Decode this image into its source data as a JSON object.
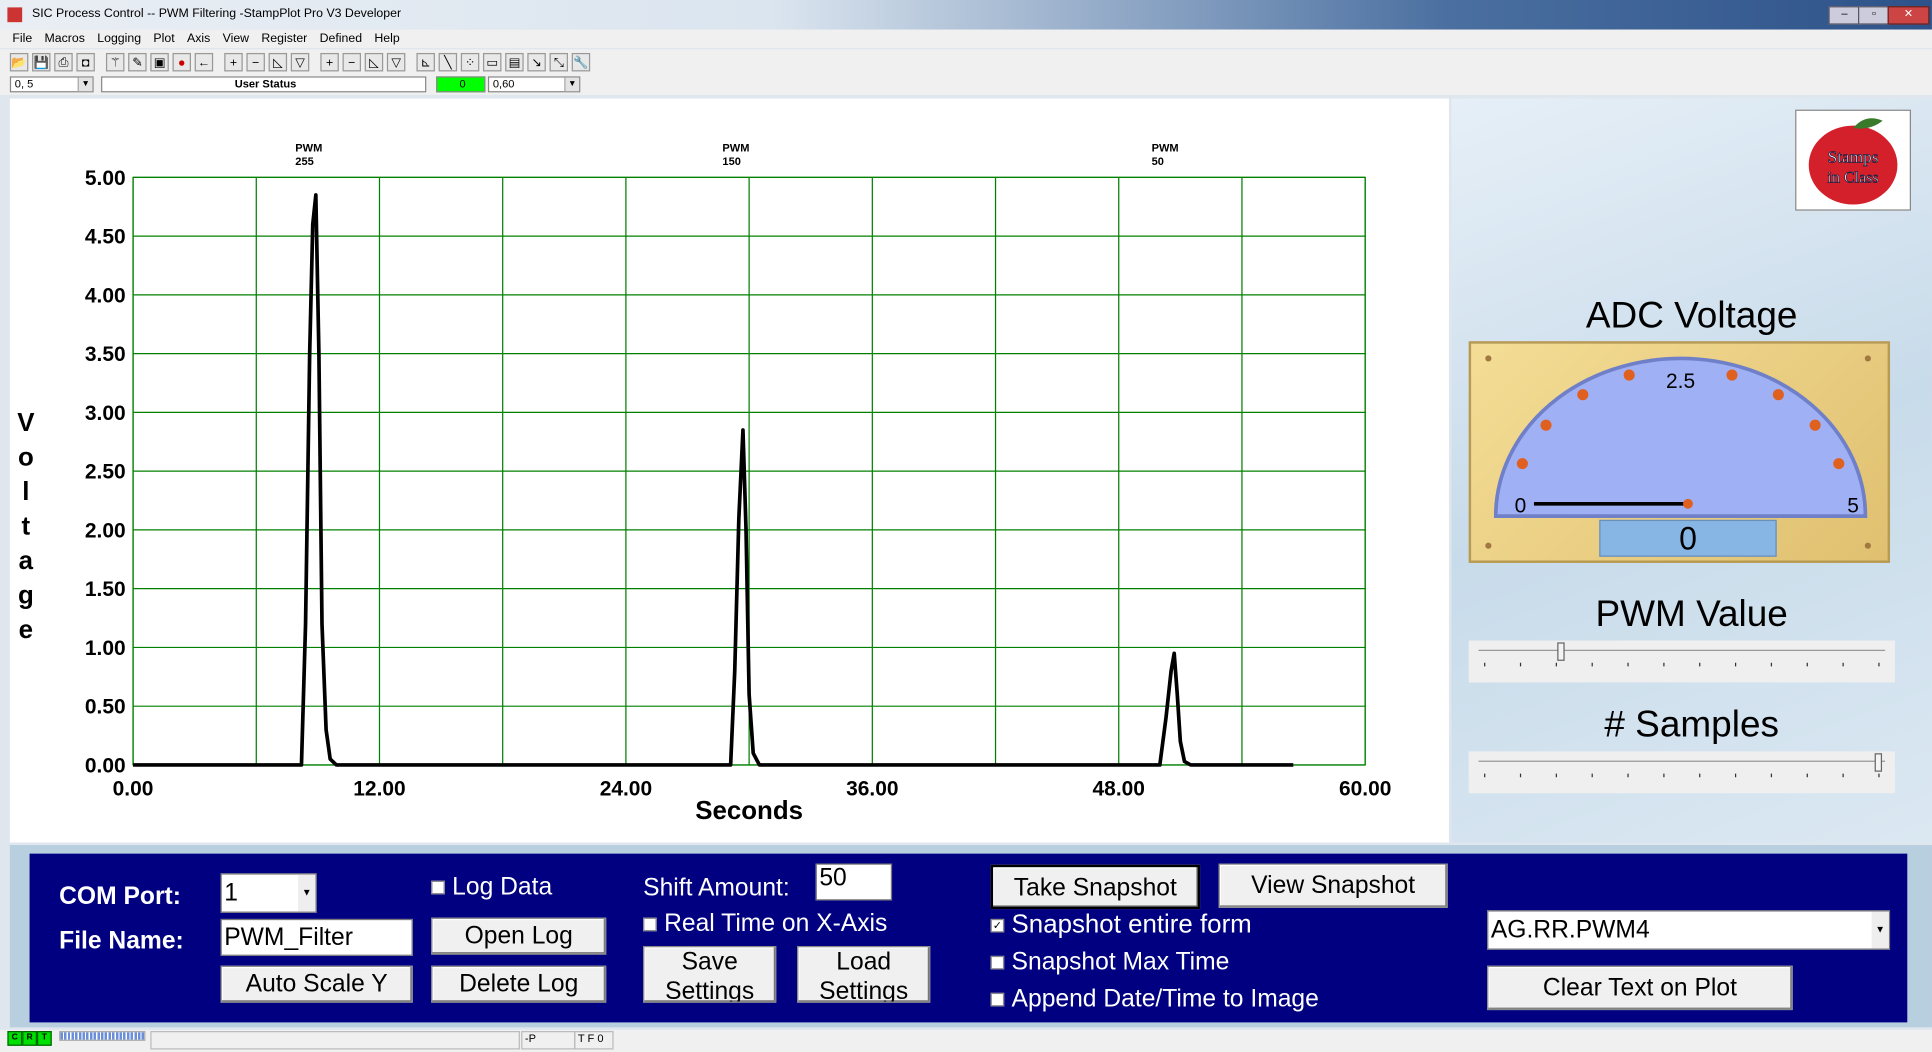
{
  "window": {
    "title": "SIC Process Control -- PWM Filtering  -StampPlot Pro V3 Developer"
  },
  "menu": [
    "File",
    "Macros",
    "Logging",
    "Plot",
    "Axis",
    "View",
    "Register",
    "Defined",
    "Help"
  ],
  "toolbar_icons": [
    "open-icon",
    "save-icon",
    "print-icon",
    "camera-icon",
    "wand-icon",
    "plot-icon",
    "monitor-icon",
    "stop-icon",
    "back-arrow-icon",
    "plus-icon",
    "minus-icon",
    "ruler-icon",
    "ruler-v-icon",
    "plus-icon",
    "minus-icon",
    "ruler-icon",
    "ruler-v-icon",
    "axis-icon",
    "pen-icon",
    "points-icon",
    "note-icon",
    "clipboard-icon",
    "pointer-icon",
    "graph-icon",
    "wrench-icon"
  ],
  "status_row": {
    "left_select": "0, 5",
    "user_status": "User Status",
    "indicator": "0",
    "right_select": "0,60",
    "indicator_color": "#00ff00"
  },
  "chart_data": {
    "type": "line",
    "xlabel": "Seconds",
    "ylabel": "Voltage",
    "xlim": [
      0,
      60
    ],
    "ylim": [
      0,
      5
    ],
    "x_ticks": [
      "0.00",
      "12.00",
      "24.00",
      "36.00",
      "48.00",
      "60.00"
    ],
    "y_ticks": [
      "0.00",
      "0.50",
      "1.00",
      "1.50",
      "2.00",
      "2.50",
      "3.00",
      "3.50",
      "4.00",
      "4.50",
      "5.00"
    ],
    "grid": true,
    "grid_color": "#008000",
    "line_color": "#000000",
    "annotations": [
      {
        "x": 8.5,
        "text": [
          "PWM",
          "255"
        ]
      },
      {
        "x": 29.3,
        "text": [
          "PWM",
          "150"
        ]
      },
      {
        "x": 50.2,
        "text": [
          "PWM",
          "50"
        ]
      }
    ],
    "points": [
      [
        0,
        0
      ],
      [
        8.2,
        0
      ],
      [
        8.4,
        1.2
      ],
      [
        8.6,
        3.5
      ],
      [
        8.75,
        4.6
      ],
      [
        8.9,
        4.85
      ],
      [
        9.05,
        3.5
      ],
      [
        9.2,
        1.2
      ],
      [
        9.4,
        0.3
      ],
      [
        9.6,
        0.05
      ],
      [
        9.9,
        0
      ],
      [
        29.1,
        0
      ],
      [
        29.3,
        0.8
      ],
      [
        29.5,
        2.1
      ],
      [
        29.7,
        2.85
      ],
      [
        29.85,
        2.0
      ],
      [
        30.0,
        0.6
      ],
      [
        30.2,
        0.1
      ],
      [
        30.5,
        0
      ],
      [
        50.0,
        0
      ],
      [
        50.3,
        0.4
      ],
      [
        50.55,
        0.8
      ],
      [
        50.7,
        0.95
      ],
      [
        50.85,
        0.6
      ],
      [
        51.0,
        0.2
      ],
      [
        51.2,
        0.03
      ],
      [
        51.5,
        0
      ],
      [
        56.5,
        0
      ]
    ]
  },
  "right": {
    "adc_title": "ADC Voltage",
    "gauge": {
      "min": "0",
      "mid": "2.5",
      "max": "5",
      "readout": "0",
      "value": 0
    },
    "pwm_title": "PWM Value",
    "pwm_fraction": 0.2,
    "samples_title": "# Samples",
    "samples_fraction": 1.0,
    "logo": "www.Stamps in Class .com"
  },
  "panel": {
    "com_label": "COM Port:",
    "com_value": "1",
    "file_label": "File Name:",
    "file_value": "PWM_Filter",
    "auto_scale": "Auto Scale Y",
    "log_data": "Log Data",
    "open_log": "Open Log",
    "delete_log": "Delete Log",
    "shift_label": "Shift Amount:",
    "shift_value": "50",
    "real_time": "Real Time on X-Axis",
    "save_settings": [
      "Save",
      "Settings"
    ],
    "load_settings": [
      "Load",
      "Settings"
    ],
    "take_snapshot": "Take Snapshot",
    "view_snapshot": "View Snapshot",
    "snap_entire": "Snapshot entire form",
    "snap_max": "Snapshot Max Time",
    "append_date": "Append Date/Time to Image",
    "macro_select": "AG.RR.PWM4",
    "clear_text": "Clear Text on Plot"
  },
  "statusbar": {
    "lights": [
      "C",
      "R",
      "T"
    ],
    "p": "-P",
    "tf": "T F 0"
  }
}
